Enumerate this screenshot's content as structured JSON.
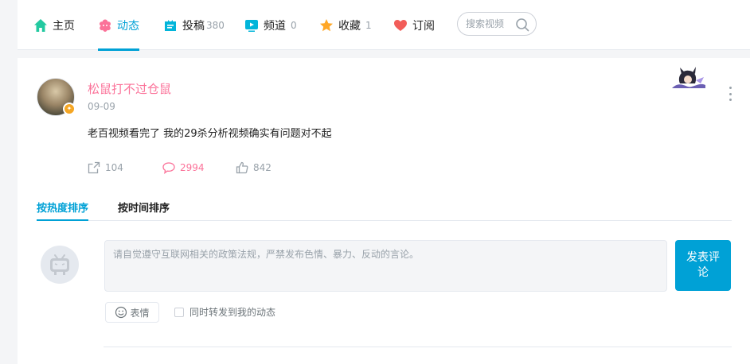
{
  "nav": {
    "items": [
      {
        "label": "主页",
        "count": "",
        "icon": "home-icon"
      },
      {
        "label": "动态",
        "count": "",
        "icon": "dynamic-icon"
      },
      {
        "label": "投稿",
        "count": "380",
        "icon": "upload-icon"
      },
      {
        "label": "频道",
        "count": "0",
        "icon": "channel-icon"
      },
      {
        "label": "收藏",
        "count": "1",
        "icon": "star-icon"
      },
      {
        "label": "订阅",
        "count": "",
        "icon": "heart-icon"
      }
    ],
    "active_index": 1,
    "search_placeholder": "搜索视频"
  },
  "post": {
    "username": "松鼠打不过仓鼠",
    "date": "09-09",
    "content": "老百视频看完了 我的29杀分析视频确实有问题对不起",
    "forward_count": "104",
    "comment_count": "2994",
    "like_count": "842"
  },
  "sort_tabs": {
    "hot": "按热度排序",
    "time": "按时间排序",
    "active": "hot"
  },
  "comment_box": {
    "placeholder": "请自觉遵守互联网相关的政策法规，严禁发布色情、暴力、反动的言论。",
    "submit_label": "发表评论",
    "emoji_label": "表情",
    "sync_label": "同时转发到我的动态"
  },
  "colors": {
    "accent": "#00a1d6",
    "pink": "#fb7299",
    "muted": "#99a2aa"
  }
}
